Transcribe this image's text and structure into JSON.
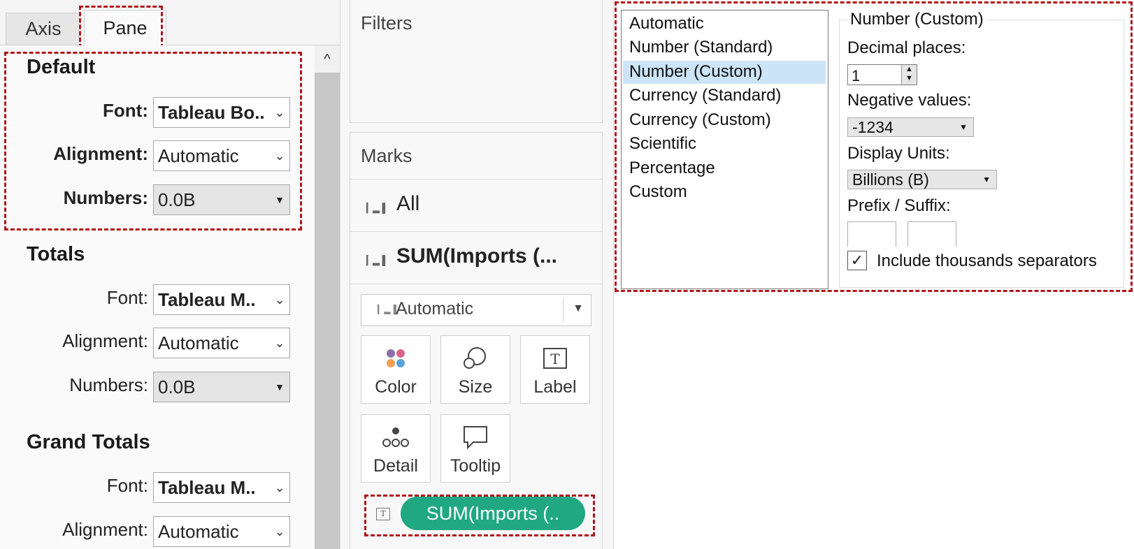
{
  "tabs": {
    "axis": "Axis",
    "pane": "Pane"
  },
  "scroll": {
    "up_glyph": "^"
  },
  "sections": {
    "default": {
      "title": "Default",
      "font_label": "Font:",
      "font_value": "Tableau Bo..",
      "alignment_label": "Alignment:",
      "alignment_value": "Automatic",
      "numbers_label": "Numbers:",
      "numbers_value": "0.0B"
    },
    "totals": {
      "title": "Totals",
      "font_label": "Font:",
      "font_value": "Tableau M..",
      "alignment_label": "Alignment:",
      "alignment_value": "Automatic",
      "numbers_label": "Numbers:",
      "numbers_value": "0.0B"
    },
    "grand_totals": {
      "title": "Grand Totals",
      "font_label": "Font:",
      "font_value": "Tableau M..",
      "alignment_label": "Alignment:",
      "alignment_value": "Automatic"
    }
  },
  "filters": {
    "label": "Filters"
  },
  "marks": {
    "label": "Marks",
    "all_label": "All",
    "measure_label": "SUM(Imports (...",
    "mark_type": "Automatic",
    "buttons": {
      "color": "Color",
      "size": "Size",
      "label": "Label",
      "detail": "Detail",
      "tooltip": "Tooltip"
    },
    "pill_label": "SUM(Imports (..",
    "pill_color": "#1fa882",
    "color_dots": [
      "#8b6fa8",
      "#d9648a",
      "#f0a051",
      "#5aa3d6"
    ]
  },
  "format": {
    "list": [
      "Automatic",
      "Number (Standard)",
      "Number (Custom)",
      "Currency (Standard)",
      "Currency (Custom)",
      "Scientific",
      "Percentage",
      "Custom"
    ],
    "selected_index": 2,
    "group_title": "Number (Custom)",
    "decimal_label": "Decimal places:",
    "decimal_value": "1",
    "negative_label": "Negative values:",
    "negative_value": "-1234",
    "units_label": "Display Units:",
    "units_value": "Billions (B)",
    "affix_label": "Prefix / Suffix:",
    "thousands_label": "Include thousands separators",
    "thousands_checked": true
  },
  "highlight_color": "#b0151b"
}
